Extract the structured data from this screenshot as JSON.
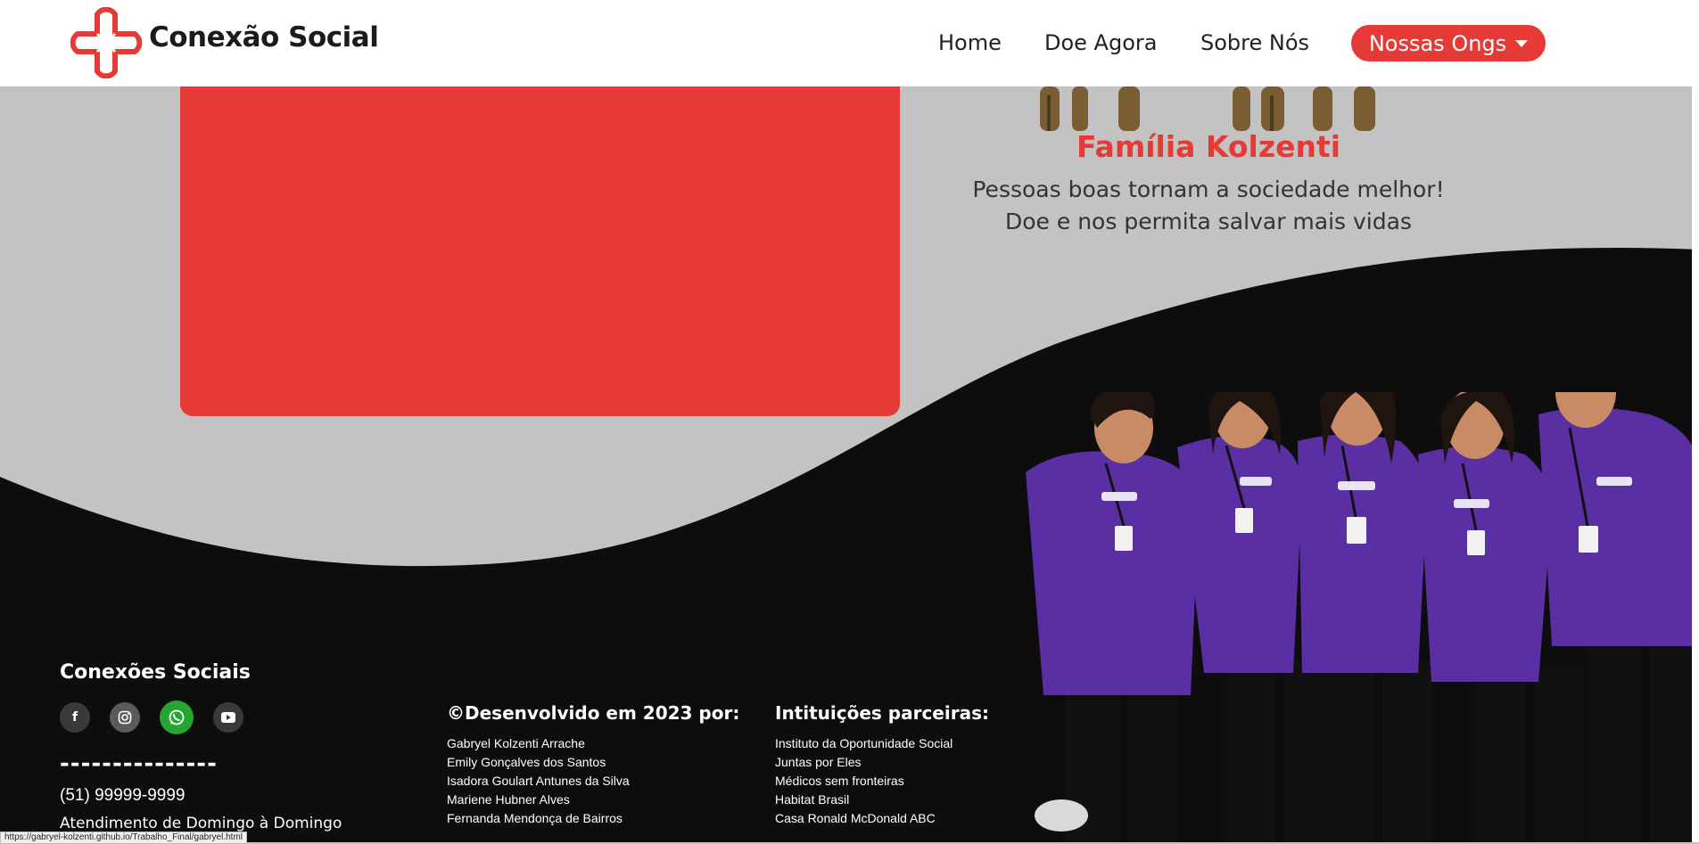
{
  "header": {
    "brand": "Conexão Social",
    "nav": [
      "Home",
      "Doe Agora",
      "Sobre Nós"
    ],
    "dropdown_label": "Nossas Ongs"
  },
  "main": {
    "family_title": "Família Kolzenti",
    "tagline_1": "Pessoas boas tornam a sociedade melhor!",
    "tagline_2": "Doe e nos permita salvar mais vidas"
  },
  "footer": {
    "social_title": "Conexões Sociais",
    "social_icons": [
      "facebook-icon",
      "instagram-icon",
      "whatsapp-icon",
      "youtube-icon"
    ],
    "divider": "---------------",
    "phone": "(51) 99999-9999",
    "hours": "Atendimento de Domingo à Domingo",
    "dev_title": "©Desenvolvido em 2023 por:",
    "developers": [
      "Gabryel Kolzenti Arrache",
      "Emily Gonçalves dos Santos",
      "Isadora Goulart Antunes da Silva",
      "Mariene Hubner Alves",
      "Fernanda Mendonça de Bairros"
    ],
    "partners_title": "Intituições parceiras:",
    "partners": [
      "Instituto da Oportunidade Social",
      "Juntas por Eles",
      "Médicos sem fronteiras",
      "Habitat Brasil",
      "Casa Ronald McDonald ABC"
    ]
  },
  "status_bar": {
    "url": "https://gabryel-kolzenti.github.io/Trabalho_Final/gabryel.html"
  },
  "colors": {
    "accent": "#e63a36",
    "background": "#c3c3c3",
    "footer": "#0d0d0d",
    "whatsapp": "#25a532"
  }
}
